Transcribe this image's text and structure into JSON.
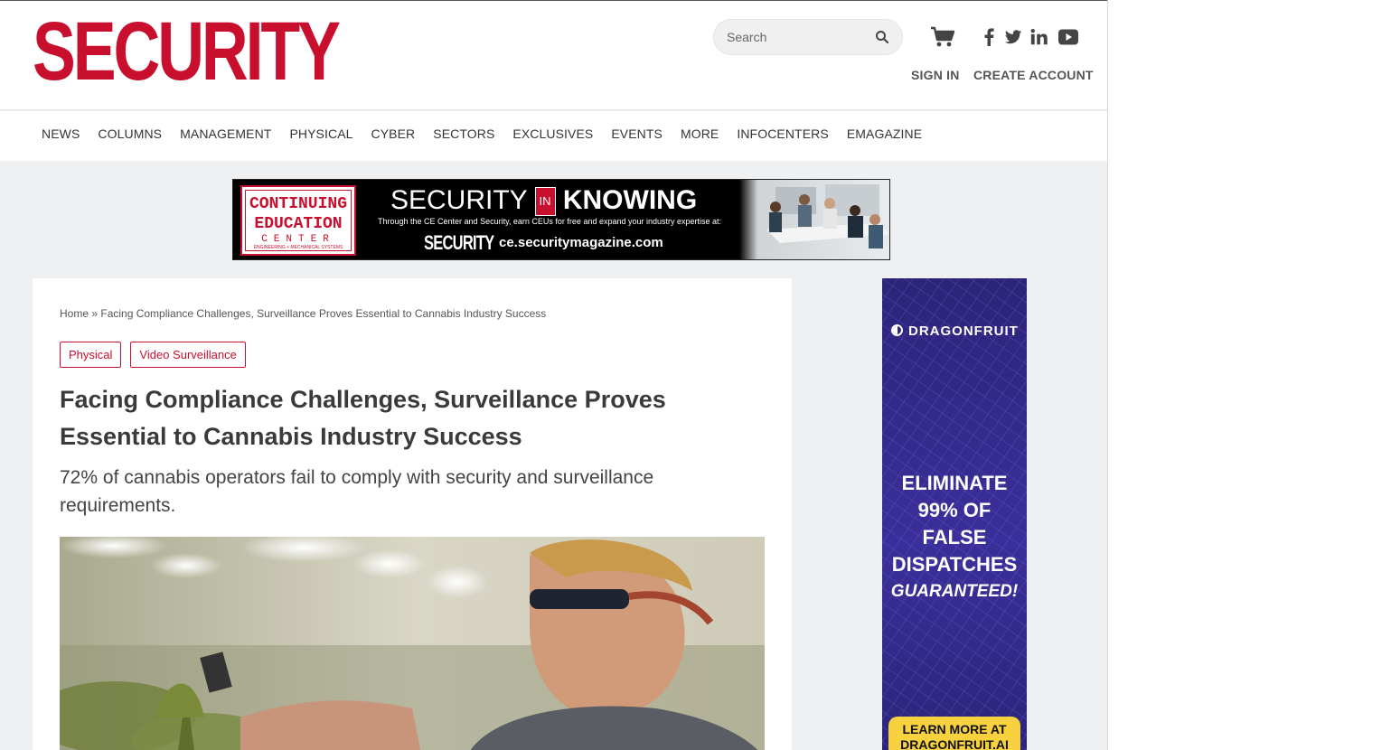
{
  "site": {
    "logo": "SECURITY",
    "brand_color": "#c8102e"
  },
  "header": {
    "search_placeholder": "Search",
    "sign_in": "SIGN IN",
    "create_account": "CREATE ACCOUNT",
    "icons": [
      "search-icon",
      "cart-icon",
      "facebook-icon",
      "twitter-icon",
      "linkedin-icon",
      "youtube-icon"
    ]
  },
  "nav": {
    "items": [
      "NEWS",
      "COLUMNS",
      "MANAGEMENT",
      "PHYSICAL",
      "CYBER",
      "SECTORS",
      "EXCLUSIVES",
      "EVENTS",
      "MORE",
      "INFOCENTERS",
      "EMAGAZINE"
    ]
  },
  "banner_ad": {
    "ce_line1": "CONTINUING",
    "ce_line2": "EDUCATION",
    "ce_line3": "CENTER",
    "ce_line4": "ENGINEERING + MECHANICAL SYSTEMS",
    "headline_a": "SECURITY",
    "headline_in": "IN",
    "headline_b": "KNOWING",
    "subline": "Through the CE Center and Security, earn CEUs for free and expand your industry expertise at:",
    "logo": "SECURITY",
    "url": "ce.securitymagazine.com"
  },
  "article": {
    "breadcrumb_home": "Home",
    "breadcrumb_sep": " » ",
    "breadcrumb_current": "Facing Compliance Challenges, Surveillance Proves Essential to Cannabis Industry Success",
    "tags": [
      "Physical",
      "Video Surveillance"
    ],
    "title": "Facing Compliance Challenges, Surveillance Proves Essential to Cannabis Industry Success",
    "dek": "72% of cannabis operators fail to comply with security and surveillance requirements."
  },
  "side_ad": {
    "brand": "DRAGONFRUIT",
    "line1": "ELIMINATE",
    "line2": "99% OF",
    "line3": "FALSE",
    "line4": "DISPATCHES",
    "line5": "GUARANTEED!",
    "cta_line1": "LEARN MORE AT",
    "cta_line2": "DRAGONFRUIT.AI",
    "bg_color": "#332a8a",
    "cta_color": "#f7d23e"
  }
}
